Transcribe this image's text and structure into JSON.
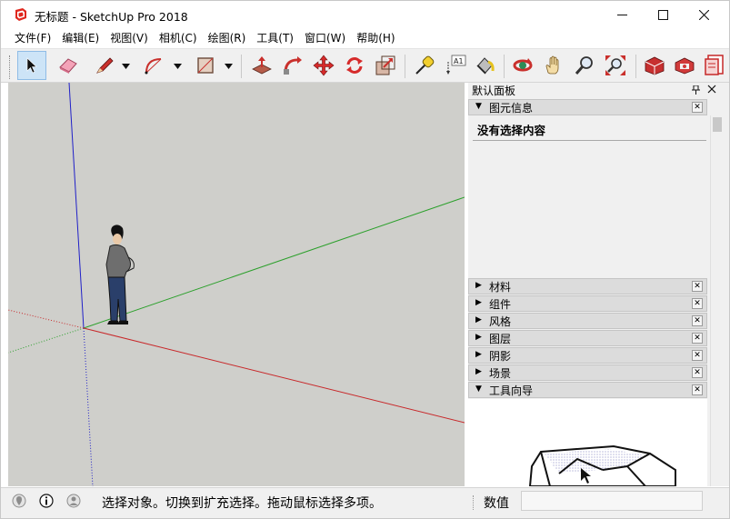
{
  "window": {
    "title": "无标题 - SketchUp Pro 2018",
    "minimize": "—",
    "maximize": "☐",
    "close": "✕"
  },
  "menu": [
    "文件(F)",
    "编辑(E)",
    "视图(V)",
    "相机(C)",
    "绘图(R)",
    "工具(T)",
    "窗口(W)",
    "帮助(H)"
  ],
  "toolbar": {
    "tools": [
      "select-icon",
      "eraser-icon",
      "line-pencil-icon",
      "arc-icon",
      "rectangle-icon",
      "push-pull-icon",
      "follow-me-icon",
      "move-icon",
      "rotate-icon",
      "scale-icon",
      "tape-measure-icon",
      "text-icon",
      "paint-bucket-icon",
      "orbit-icon",
      "pan-icon",
      "zoom-icon",
      "zoom-extents-icon",
      "warehouse-icon",
      "extension-warehouse-icon",
      "layout-icon"
    ],
    "text_tool_label": "A1"
  },
  "panel": {
    "title": "默认面板",
    "pin": "📌",
    "close": "✕",
    "entity_info": {
      "label": "图元信息",
      "content": "没有选择内容"
    },
    "trays": [
      {
        "label": "材料"
      },
      {
        "label": "组件"
      },
      {
        "label": "风格"
      },
      {
        "label": "图层"
      },
      {
        "label": "阴影"
      },
      {
        "label": "场景"
      },
      {
        "label": "工具向导"
      }
    ]
  },
  "status": {
    "text": "选择对象。切换到扩充选择。拖动鼠标选择多项。",
    "measure_label": "数值",
    "measure_value": ""
  },
  "colors": {
    "axis_red": "#c8282a",
    "axis_green": "#2ca02c",
    "axis_blue": "#2020c8",
    "viewport_ground": "#cfcfcb",
    "viewport_sky": "#d8d8d5"
  }
}
